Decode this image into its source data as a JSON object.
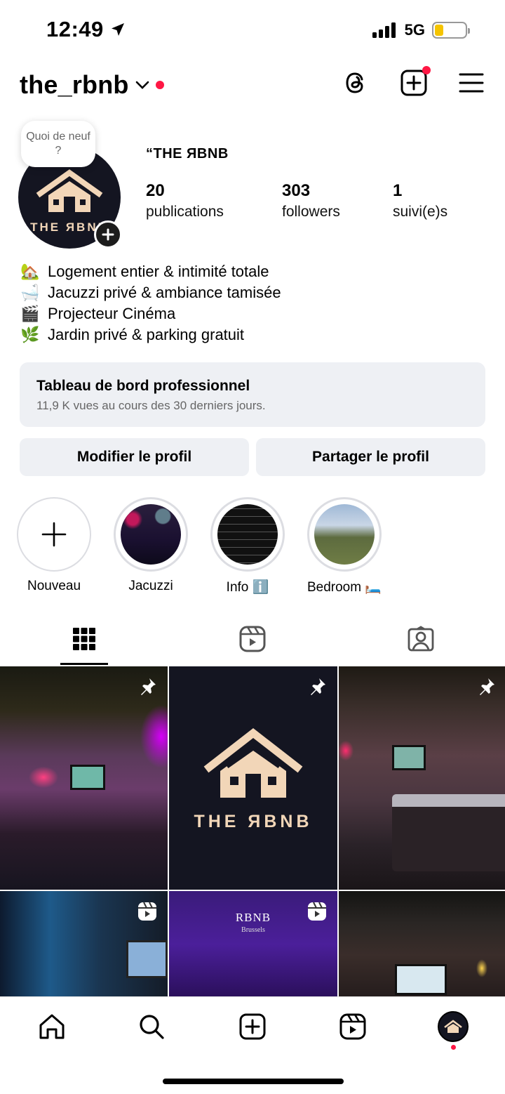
{
  "status_bar": {
    "time": "12:49",
    "network": "5G",
    "battery_level": 0.25,
    "battery_color": "#f5c400"
  },
  "header": {
    "username": "the_rbnb",
    "icons": [
      "threads-icon",
      "new-post-icon",
      "menu-icon"
    ]
  },
  "profile": {
    "bubble_text": "Quoi de neuf ?",
    "avatar_text": "THE ЯBNB",
    "display_name": "“THE ЯBNB",
    "stats": [
      {
        "value": "20",
        "label": "publications"
      },
      {
        "value": "303",
        "label": "followers"
      },
      {
        "value": "1",
        "label": "suivi(e)s"
      }
    ],
    "bio": [
      {
        "emoji": "🏡",
        "text": "Logement entier & intimité totale"
      },
      {
        "emoji": "🛁",
        "text": "Jacuzzi privé & ambiance tamisée"
      },
      {
        "emoji": "🎬",
        "text": "Projecteur Cinéma"
      },
      {
        "emoji": "🌿",
        "text": "Jardin privé & parking gratuit"
      }
    ]
  },
  "dashboard": {
    "title": "Tableau de bord professionnel",
    "subtitle": "11,9 K vues au cours des 30 derniers jours."
  },
  "buttons": {
    "edit": "Modifier le profil",
    "share": "Partager le profil"
  },
  "highlights": [
    {
      "label": "Nouveau"
    },
    {
      "label": "Jacuzzi"
    },
    {
      "label": "Info ℹ️"
    },
    {
      "label": "Bedroom 🛏️"
    }
  ],
  "grid": {
    "logo_text": "THE ЯBNB",
    "cell5_title": "RBNB",
    "cell5_sub": "Brussels"
  },
  "colors": {
    "accent_red": "#ff1744",
    "brand_dark": "#141521",
    "brand_beige": "#f2d6b8",
    "button_bg": "#eef0f4"
  }
}
